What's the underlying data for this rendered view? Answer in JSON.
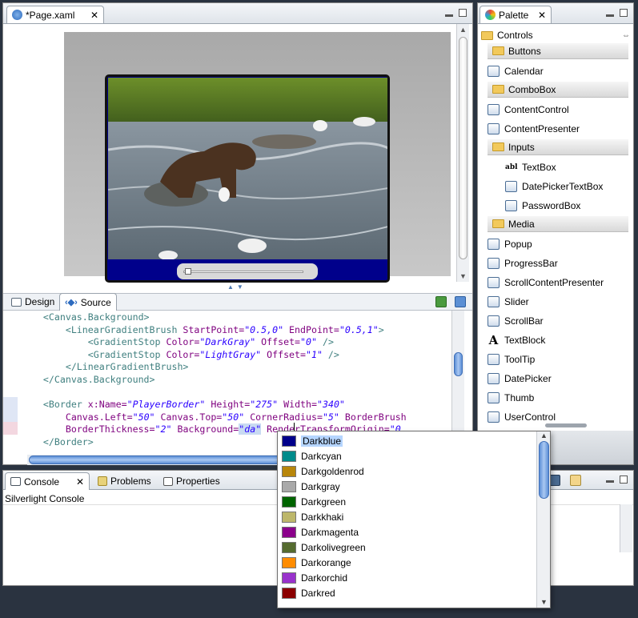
{
  "editor": {
    "tab_title": "*Page.xaml",
    "design_tab": "Design",
    "source_tab": "Source"
  },
  "palette": {
    "tab_title": "Palette",
    "section": "Controls",
    "items": [
      {
        "kind": "group",
        "label": "Buttons"
      },
      {
        "kind": "item",
        "label": "Calendar",
        "icon": "calendar-icon"
      },
      {
        "kind": "group",
        "label": "ComboBox"
      },
      {
        "kind": "item",
        "label": "ContentControl",
        "icon": "content-control-icon"
      },
      {
        "kind": "item",
        "label": "ContentPresenter",
        "icon": "content-presenter-icon"
      },
      {
        "kind": "group",
        "label": "Inputs"
      },
      {
        "kind": "sub",
        "label": "TextBox",
        "icon": "textbox-icon",
        "glyph": "abl"
      },
      {
        "kind": "sub",
        "label": "DatePickerTextBox",
        "icon": "datepicker-textbox-icon"
      },
      {
        "kind": "sub",
        "label": "PasswordBox",
        "icon": "password-box-icon"
      },
      {
        "kind": "group",
        "label": "Media"
      },
      {
        "kind": "item",
        "label": "Popup",
        "icon": "popup-icon"
      },
      {
        "kind": "item",
        "label": "ProgressBar",
        "icon": "progressbar-icon"
      },
      {
        "kind": "item",
        "label": "ScrollContentPresenter",
        "icon": "scroll-content-presenter-icon"
      },
      {
        "kind": "item",
        "label": "Slider",
        "icon": "slider-icon"
      },
      {
        "kind": "item",
        "label": "ScrollBar",
        "icon": "scrollbar-icon"
      },
      {
        "kind": "item",
        "label": "TextBlock",
        "icon": "textblock-icon",
        "glyph": "A"
      },
      {
        "kind": "item",
        "label": "ToolTip",
        "icon": "tooltip-icon"
      },
      {
        "kind": "item",
        "label": "DatePicker",
        "icon": "datepicker-icon"
      },
      {
        "kind": "item",
        "label": "Thumb",
        "icon": "thumb-icon"
      },
      {
        "kind": "item",
        "label": "UserControl",
        "icon": "usercontrol-icon"
      }
    ]
  },
  "console": {
    "tabs": [
      "Console",
      "Problems",
      "Properties"
    ],
    "title": "Silverlight Console"
  },
  "code_lines": [
    [
      [
        "t",
        "    <Canvas.Background>"
      ]
    ],
    [
      [
        "t",
        "        <LinearGradientBrush "
      ],
      [
        "a",
        "StartPoint="
      ],
      [
        "v",
        "\"0.5,0\""
      ],
      [
        "a",
        " EndPoint="
      ],
      [
        "v",
        "\"0.5,1\""
      ],
      [
        "t",
        ">"
      ]
    ],
    [
      [
        "t",
        "            <GradientStop "
      ],
      [
        "a",
        "Color="
      ],
      [
        "v",
        "\"DarkGray\""
      ],
      [
        "a",
        " Offset="
      ],
      [
        "v",
        "\"0\""
      ],
      [
        "t",
        " />"
      ]
    ],
    [
      [
        "t",
        "            <GradientStop "
      ],
      [
        "a",
        "Color="
      ],
      [
        "v",
        "\"LightGray\""
      ],
      [
        "a",
        " Offset="
      ],
      [
        "v",
        "\"1\""
      ],
      [
        "t",
        " />"
      ]
    ],
    [
      [
        "t",
        "        </LinearGradientBrush>"
      ]
    ],
    [
      [
        "t",
        "    </Canvas.Background>"
      ]
    ],
    [
      [
        "t",
        ""
      ]
    ],
    [
      [
        "t",
        "    <Border "
      ],
      [
        "a",
        "x:Name="
      ],
      [
        "v",
        "\"PlayerBorder\""
      ],
      [
        "a",
        " Height="
      ],
      [
        "v",
        "\"275\""
      ],
      [
        "a",
        " Width="
      ],
      [
        "v",
        "\"340\""
      ]
    ],
    [
      [
        "a",
        "        Canvas.Left="
      ],
      [
        "v",
        "\"50\""
      ],
      [
        "a",
        " Canvas.Top="
      ],
      [
        "v",
        "\"50\""
      ],
      [
        "a",
        " CornerRadius="
      ],
      [
        "v",
        "\"5\""
      ],
      [
        "a",
        " BorderBrush"
      ]
    ],
    [
      [
        "a",
        "        BorderThickness="
      ],
      [
        "v",
        "\"2\""
      ],
      [
        "a",
        " Background="
      ],
      [
        "v",
        "\"da\""
      ],
      [
        "a",
        " RenderTransformOrigin="
      ],
      [
        "v",
        "\"0."
      ]
    ],
    [
      [
        "t",
        "    </Border>"
      ]
    ]
  ],
  "dropdown": {
    "selected": "Darkblue",
    "options": [
      {
        "name": "Darkblue",
        "color": "#00008b"
      },
      {
        "name": "Darkcyan",
        "color": "#008b8b"
      },
      {
        "name": "Darkgoldenrod",
        "color": "#b8860b"
      },
      {
        "name": "Darkgray",
        "color": "#a9a9a9"
      },
      {
        "name": "Darkgreen",
        "color": "#006400"
      },
      {
        "name": "Darkkhaki",
        "color": "#bdb76b"
      },
      {
        "name": "Darkmagenta",
        "color": "#8b008b"
      },
      {
        "name": "Darkolivegreen",
        "color": "#556b2f"
      },
      {
        "name": "Darkorange",
        "color": "#ff8c00"
      },
      {
        "name": "Darkorchid",
        "color": "#9932cc"
      },
      {
        "name": "Darkred",
        "color": "#8b0000"
      }
    ]
  }
}
